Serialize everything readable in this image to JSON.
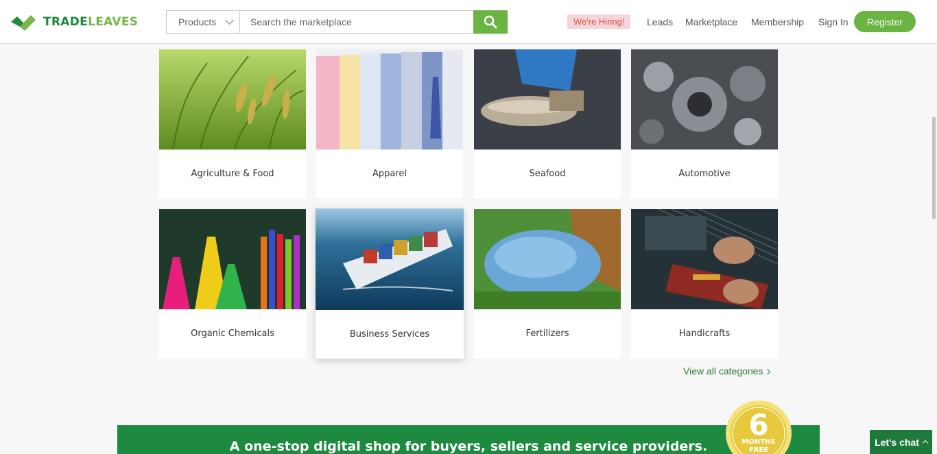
{
  "brand": {
    "name_part1": "TRADE",
    "name_part2": "LEAVES"
  },
  "search": {
    "category": "Products",
    "placeholder": "Search the marketplace"
  },
  "nav": {
    "hiring": "We're Hiring!",
    "leads": "Leads",
    "marketplace": "Marketplace",
    "membership": "Membership",
    "sign_in": "Sign In",
    "register": "Register"
  },
  "categories": [
    {
      "label": "Agriculture & Food",
      "icon": "rice-field-photo"
    },
    {
      "label": "Apparel",
      "icon": "shirts-photo"
    },
    {
      "label": "Seafood",
      "icon": "fish-photo"
    },
    {
      "label": "Automotive",
      "icon": "engine-photo"
    },
    {
      "label": "Organic Chemicals",
      "icon": "lab-flasks-photo"
    },
    {
      "label": "Business Services",
      "icon": "cargo-ship-photo"
    },
    {
      "label": "Fertilizers",
      "icon": "fertilizer-granules-photo"
    },
    {
      "label": "Handicrafts",
      "icon": "loom-weaving-photo"
    }
  ],
  "view_all": "View all categories",
  "banner": {
    "text": "A one-stop digital shop for buyers, sellers and service providers.",
    "seal_number": "6",
    "seal_line1": "MONTHS",
    "seal_line2": "FREE"
  },
  "chat": {
    "label": "Let's chat"
  },
  "colors": {
    "brand_green": "#6ab443",
    "dark_green": "#1d8a3f",
    "hiring_bg": "#f6d5d8",
    "hiring_text": "#d9534f"
  }
}
